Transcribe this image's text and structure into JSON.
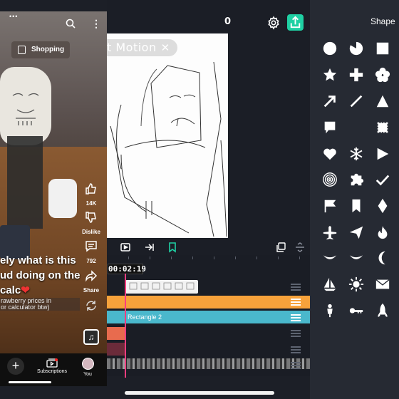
{
  "editor": {
    "timecode_top": "0",
    "watermark_text": "t Motion",
    "watermark_close": "✕",
    "playhead_time": "00:02:19",
    "tracks": {
      "teal_label": "Rectangle 2"
    }
  },
  "shape_panel": {
    "title": "Shape",
    "shapes": [
      "circle-shape",
      "pie-shape",
      "square-shape",
      "star-shape",
      "plus-shape",
      "flower-shape",
      "arrow-shape",
      "line-shape",
      "triangle-shape",
      "speech-bubble-shape",
      "crescent-shape",
      "stamp-shape",
      "heart-shape",
      "snowflake-shape",
      "play-shape",
      "spiral-shape",
      "puzzle-shape",
      "check-shape",
      "flag-shape",
      "bookmark-shape",
      "diamond-shape",
      "airplane-shape",
      "paper-plane-shape",
      "flame-shape",
      "smile-shape",
      "frown-shape",
      "moon-shape",
      "sailboat-shape",
      "sun-shape",
      "envelope-shape",
      "person-shape",
      "key-shape",
      "rocket-shape"
    ]
  },
  "pip_video": {
    "dots": "•••",
    "more": "⋮",
    "shopping_label": "Shopping",
    "caption": "ely what is this\nud doing on the\ncalc",
    "caption_sub": "rawberry prices in\nor calculator btw)",
    "actions": {
      "like_count": "14K",
      "dislike_label": "Dislike",
      "comments_count": "792",
      "share_label": "Share"
    },
    "nav": {
      "add": "+",
      "subscriptions": "Subscriptions",
      "you": "You"
    }
  },
  "colors": {
    "accent_export": "#1fd0a3",
    "playhead": "#ff3d7f",
    "track_orange": "#f7a23b",
    "track_teal": "#4ab8cc"
  }
}
